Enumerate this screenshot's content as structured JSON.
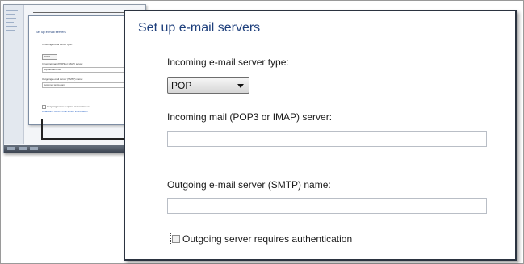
{
  "main": {
    "title": "Set up e-mail servers",
    "incoming_type_label": "Incoming e-mail server type:",
    "incoming_type_value": "POP",
    "incoming_server_label": "Incoming mail (POP3 or IMAP) server:",
    "incoming_server_value": "",
    "outgoing_server_label": "Outgoing e-mail server (SMTP) name:",
    "outgoing_server_value": "",
    "auth_checkbox_label": "Outgoing server requires authentication",
    "auth_checked": false
  },
  "thumbnail": {
    "title": "Set up e-mail servers",
    "incoming_type_label": "Incoming e-mail server type:",
    "incoming_type_value": "POP3",
    "incoming_server_label": "Incoming mail (POP3 or IMAP) server:",
    "incoming_server_value": "pop.domain.com",
    "outgoing_server_label": "Outgoing e-mail server (SMTP) name:",
    "outgoing_server_value": "customer.smtp.com",
    "auth_checkbox_label": "Outgoing server requires authentication",
    "help_link": "What can I do to e-mail server information?"
  },
  "colors": {
    "title_blue": "#1e3f7c",
    "link_blue": "#2a64c5",
    "panel_border": "#2b3340"
  }
}
